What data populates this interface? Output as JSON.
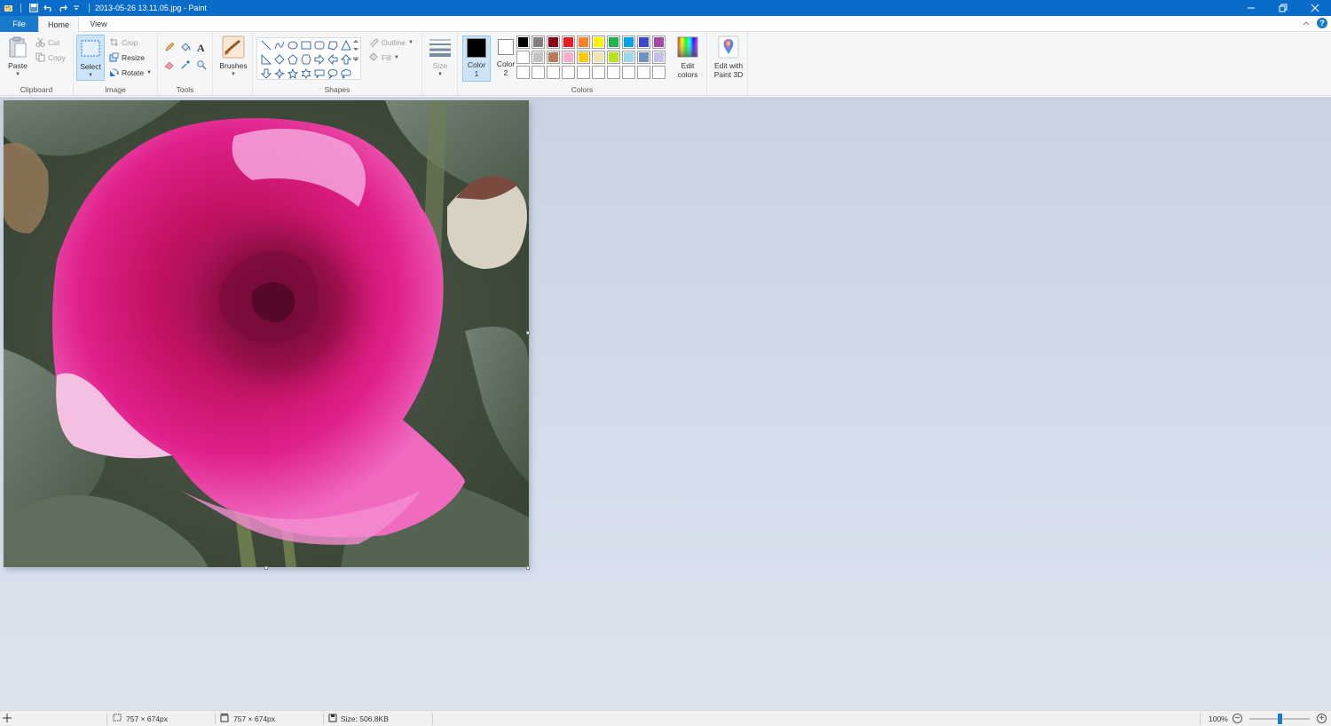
{
  "titlebar": {
    "title": "2013-05-26 13.11.05.jpg - Paint",
    "bg_color": "#0a6cc9"
  },
  "tabs": [
    {
      "label": "File"
    },
    {
      "label": "Home"
    },
    {
      "label": "View"
    }
  ],
  "ribbon": {
    "clipboard": {
      "paste": "Paste",
      "cut": "Cut",
      "copy": "Copy",
      "group_label": "Clipboard"
    },
    "image": {
      "select": "Select",
      "crop": "Crop",
      "resize": "Resize",
      "rotate": "Rotate",
      "group_label": "Image"
    },
    "tools": {
      "group_label": "Tools",
      "items": [
        "pencil-icon",
        "fill-bucket-icon",
        "text-icon",
        "eraser-icon",
        "color-picker-icon",
        "magnifier-icon"
      ]
    },
    "brushes": {
      "label": "Brushes"
    },
    "shapes": {
      "outline": "Outline",
      "fill": "Fill",
      "group_label": "Shapes"
    },
    "size": {
      "label": "Size"
    },
    "colors": {
      "color1": "Color",
      "color1_num": "1",
      "color2": "Color",
      "color2_num": "2",
      "color1_value": "#000000",
      "color2_value": "#ffffff",
      "edit_colors_line1": "Edit",
      "edit_colors_line2": "colors",
      "group_label": "Colors",
      "palette": [
        "#000000",
        "#7f7f7f",
        "#880015",
        "#ed1c24",
        "#ff7f27",
        "#fff200",
        "#22b14c",
        "#00a2e8",
        "#3f48cc",
        "#a349a4",
        "#ffffff",
        "#c3c3c3",
        "#b97a57",
        "#ffaec9",
        "#ffc90e",
        "#efe4b0",
        "#b5e61d",
        "#99d9ea",
        "#7092be",
        "#c8bfe7",
        "#ffffff",
        "#ffffff",
        "#ffffff",
        "#ffffff",
        "#ffffff",
        "#ffffff",
        "#ffffff",
        "#ffffff",
        "#ffffff",
        "#ffffff"
      ]
    },
    "paint3d": {
      "line1": "Edit with",
      "line2": "Paint 3D"
    }
  },
  "statusbar": {
    "selection_size": "757 × 674px",
    "image_size": "757 × 674px",
    "file_size": "Size: 506.8KB",
    "zoom": "100%",
    "zoom_level": 0.5
  }
}
